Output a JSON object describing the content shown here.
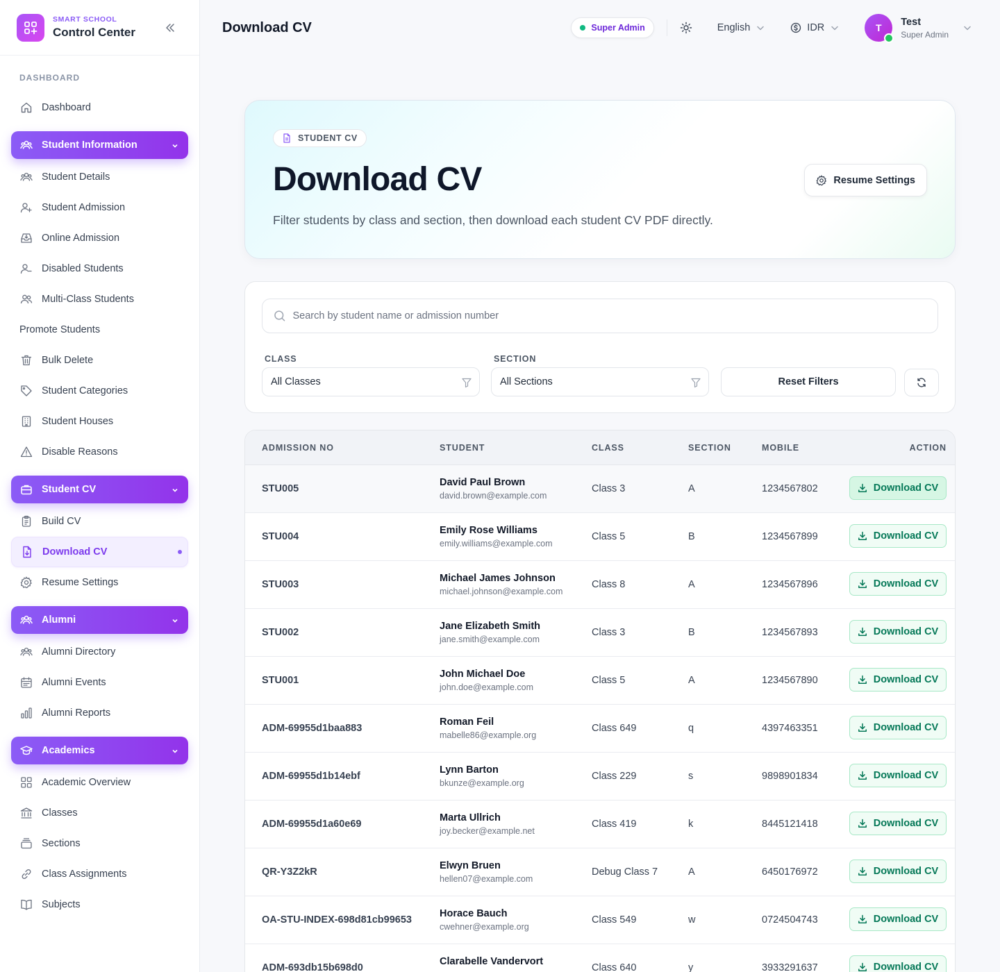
{
  "brand": {
    "small": "SMART SCHOOL",
    "big": "Control Center"
  },
  "sidebar": {
    "section_label": "DASHBOARD",
    "dashboard": "Dashboard",
    "groups": {
      "student_information": {
        "label": "Student Information",
        "items": [
          "Student Details",
          "Student Admission",
          "Online Admission",
          "Disabled Students",
          "Multi-Class Students",
          "Promote Students",
          "Bulk Delete",
          "Student Categories",
          "Student Houses",
          "Disable Reasons"
        ]
      },
      "student_cv": {
        "label": "Student CV",
        "items": [
          "Build CV",
          "Download CV",
          "Resume Settings"
        ]
      },
      "alumni": {
        "label": "Alumni",
        "items": [
          "Alumni Directory",
          "Alumni Events",
          "Alumni Reports"
        ]
      },
      "academics": {
        "label": "Academics",
        "items": [
          "Academic Overview",
          "Classes",
          "Sections",
          "Class Assignments",
          "Subjects"
        ]
      }
    }
  },
  "header": {
    "title": "Download CV",
    "role_pill": "Super Admin",
    "language": "English",
    "currency": "IDR",
    "user": {
      "initial": "T",
      "name": "Test",
      "role": "Super Admin"
    }
  },
  "hero": {
    "badge": "STUDENT CV",
    "title": "Download CV",
    "description": "Filter students by class and section, then download each student CV PDF directly.",
    "resume_button": "Resume Settings"
  },
  "filters": {
    "search_placeholder": "Search by student name or admission number",
    "class_label": "CLASS",
    "class_value": "All Classes",
    "section_label": "SECTION",
    "section_value": "All Sections",
    "reset_label": "Reset Filters"
  },
  "table": {
    "headers": [
      "ADMISSION NO",
      "STUDENT",
      "CLASS",
      "SECTION",
      "MOBILE",
      "ACTION"
    ],
    "action_label": "Download CV",
    "rows": [
      {
        "adm": "STU005",
        "name": "David Paul Brown",
        "email": "david.brown@example.com",
        "cls": "Class 3",
        "sec": "A",
        "mob": "1234567802"
      },
      {
        "adm": "STU004",
        "name": "Emily Rose Williams",
        "email": "emily.williams@example.com",
        "cls": "Class 5",
        "sec": "B",
        "mob": "1234567899"
      },
      {
        "adm": "STU003",
        "name": "Michael James Johnson",
        "email": "michael.johnson@example.com",
        "cls": "Class 8",
        "sec": "A",
        "mob": "1234567896"
      },
      {
        "adm": "STU002",
        "name": "Jane Elizabeth Smith",
        "email": "jane.smith@example.com",
        "cls": "Class 3",
        "sec": "B",
        "mob": "1234567893"
      },
      {
        "adm": "STU001",
        "name": "John Michael Doe",
        "email": "john.doe@example.com",
        "cls": "Class 5",
        "sec": "A",
        "mob": "1234567890"
      },
      {
        "adm": "ADM-69955d1baa883",
        "name": "Roman Feil",
        "email": "mabelle86@example.org",
        "cls": "Class 649",
        "sec": "q",
        "mob": "4397463351"
      },
      {
        "adm": "ADM-69955d1b14ebf",
        "name": "Lynn Barton",
        "email": "bkunze@example.org",
        "cls": "Class 229",
        "sec": "s",
        "mob": "9898901834"
      },
      {
        "adm": "ADM-69955d1a60e69",
        "name": "Marta Ullrich",
        "email": "joy.becker@example.net",
        "cls": "Class 419",
        "sec": "k",
        "mob": "8445121418"
      },
      {
        "adm": "QR-Y3Z2kR",
        "name": "Elwyn Bruen",
        "email": "hellen07@example.com",
        "cls": "Debug Class 7",
        "sec": "A",
        "mob": "6450176972"
      },
      {
        "adm": "OA-STU-INDEX-698d81cb99653",
        "name": "Horace Bauch",
        "email": "cwehner@example.org",
        "cls": "Class 549",
        "sec": "w",
        "mob": "0724504743"
      },
      {
        "adm": "ADM-693db15b698d0",
        "name": "Clarabelle Vandervort",
        "email": "",
        "cls": "Class 640",
        "sec": "y",
        "mob": "3933291637"
      }
    ]
  },
  "colors": {
    "accent": "#8b5cf6",
    "success": "#047857",
    "online": "#22c55e"
  }
}
